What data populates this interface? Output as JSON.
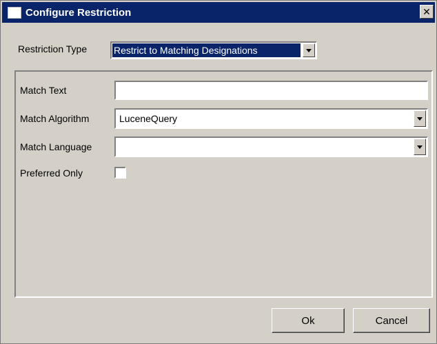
{
  "window": {
    "title": "Configure Restriction",
    "close_glyph": "✕"
  },
  "restriction_type": {
    "label": "Restriction Type",
    "selected": "Restrict to Matching Designations"
  },
  "form": {
    "match_text": {
      "label": "Match Text",
      "value": ""
    },
    "match_algorithm": {
      "label": "Match Algorithm",
      "selected": "LuceneQuery"
    },
    "match_language": {
      "label": "Match Language",
      "selected": ""
    },
    "preferred_only": {
      "label": "Preferred Only",
      "checked": false
    }
  },
  "buttons": {
    "ok": "Ok",
    "cancel": "Cancel"
  },
  "colors": {
    "titlebar": "#0a246a",
    "face": "#d4d0c8"
  }
}
